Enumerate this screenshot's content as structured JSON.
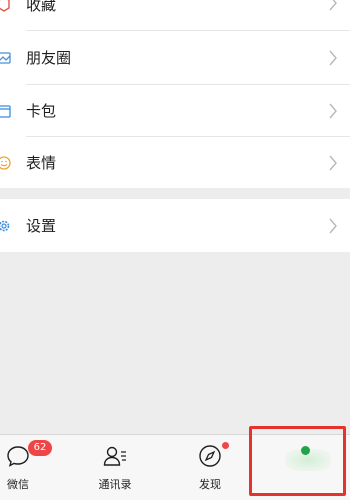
{
  "menu_group_1": [
    {
      "label": "收藏",
      "icon": "favorites-icon"
    },
    {
      "label": "朋友圈",
      "icon": "moments-icon"
    },
    {
      "label": "卡包",
      "icon": "card-wallet-icon"
    },
    {
      "label": "表情",
      "icon": "stickers-icon"
    }
  ],
  "menu_group_2": [
    {
      "label": "设置",
      "icon": "settings-gear-icon"
    }
  ],
  "tabbar": {
    "chats": {
      "label": "微信",
      "badge": "62"
    },
    "contacts": {
      "label": "通讯录"
    },
    "discover": {
      "label": "发现"
    }
  },
  "colors": {
    "badge": "#f04545",
    "highlight_box": "#e5322d",
    "me_tab_dot": "#1fa547",
    "page_background": "#ededed"
  }
}
